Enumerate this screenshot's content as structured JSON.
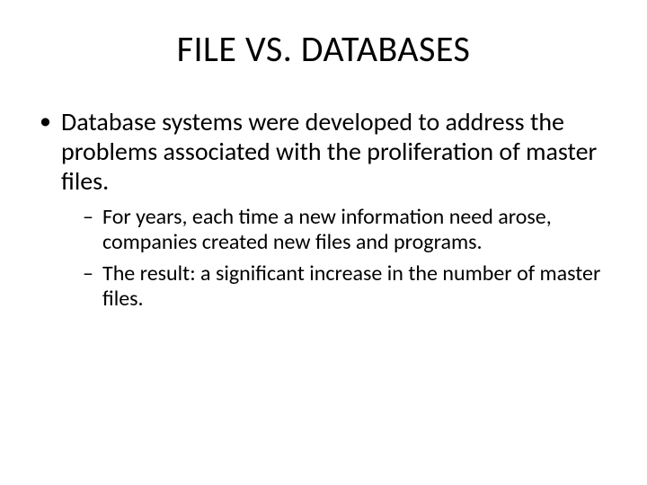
{
  "title": "FILE VS. DATABASES",
  "bullets": [
    {
      "text": "Database systems were developed to address the problems associated with the proliferation of master files.",
      "sub": [
        "For years, each time a new information need arose, companies created new files and programs.",
        "The result:  a significant increase in the number of master files."
      ]
    }
  ]
}
